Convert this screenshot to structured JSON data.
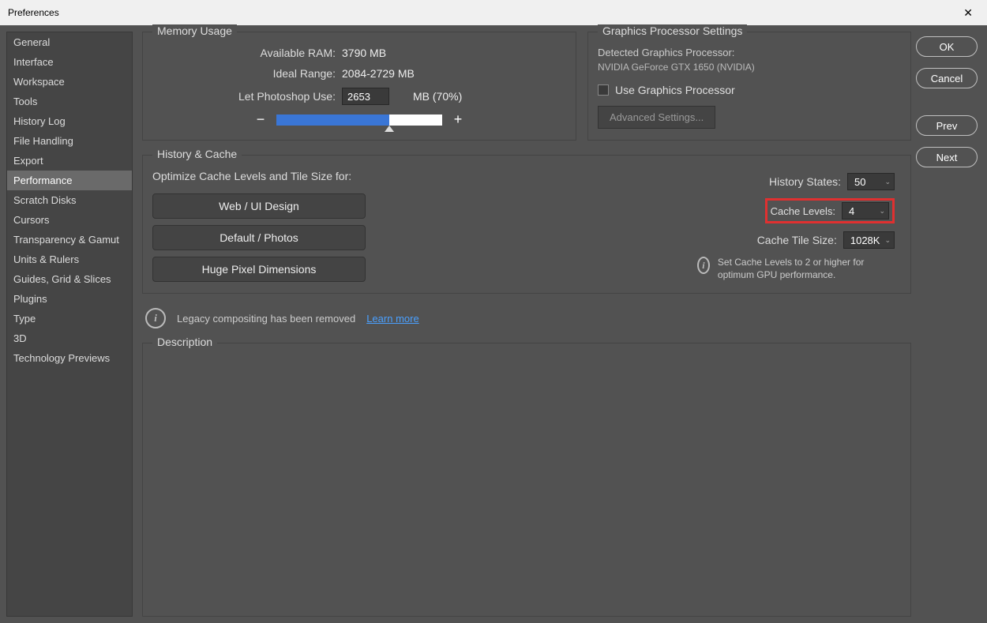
{
  "titlebar": {
    "title": "Preferences"
  },
  "sidebar": {
    "items": [
      {
        "label": "General"
      },
      {
        "label": "Interface"
      },
      {
        "label": "Workspace"
      },
      {
        "label": "Tools"
      },
      {
        "label": "History Log"
      },
      {
        "label": "File Handling"
      },
      {
        "label": "Export"
      },
      {
        "label": "Performance",
        "selected": true
      },
      {
        "label": "Scratch Disks"
      },
      {
        "label": "Cursors"
      },
      {
        "label": "Transparency & Gamut"
      },
      {
        "label": "Units & Rulers"
      },
      {
        "label": "Guides, Grid & Slices"
      },
      {
        "label": "Plugins"
      },
      {
        "label": "Type"
      },
      {
        "label": "3D"
      },
      {
        "label": "Technology Previews"
      }
    ]
  },
  "buttons": {
    "ok": "OK",
    "cancel": "Cancel",
    "prev": "Prev",
    "next": "Next"
  },
  "memory": {
    "legend": "Memory Usage",
    "avail_label": "Available RAM:",
    "avail_value": "3790 MB",
    "ideal_label": "Ideal Range:",
    "ideal_value": "2084-2729 MB",
    "use_label": "Let Photoshop Use:",
    "use_value": "2653",
    "use_suffix": "MB (70%)"
  },
  "gpu": {
    "legend": "Graphics Processor Settings",
    "detected_label": "Detected Graphics Processor:",
    "detected_value": "NVIDIA GeForce GTX 1650 (NVIDIA)",
    "use_label": "Use Graphics Processor",
    "adv_label": "Advanced Settings..."
  },
  "history": {
    "legend": "History & Cache",
    "opt_caption": "Optimize Cache Levels and Tile Size for:",
    "btn_web": "Web / UI Design",
    "btn_default": "Default / Photos",
    "btn_huge": "Huge Pixel Dimensions",
    "states_label": "History States:",
    "states_value": "50",
    "levels_label": "Cache Levels:",
    "levels_value": "4",
    "tile_label": "Cache Tile Size:",
    "tile_value": "1028K",
    "hint": "Set Cache Levels to 2 or higher for optimum GPU performance."
  },
  "legacy": {
    "text": "Legacy compositing has been removed",
    "link": "Learn more"
  },
  "desc": {
    "legend": "Description"
  }
}
